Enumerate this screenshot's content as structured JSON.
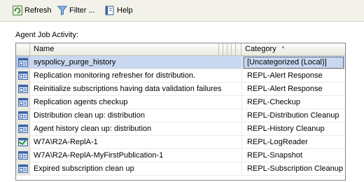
{
  "toolbar": {
    "refresh_label": "Refresh",
    "filter_label": "Filter ...",
    "help_label": "Help"
  },
  "activity_label": "Agent Job Activity:",
  "grid": {
    "columns": {
      "name": "Name",
      "category": "Category"
    },
    "sort_indicator": "▲",
    "rows": [
      {
        "name": "syspolicy_purge_history",
        "category": "[Uncategorized (Local)]",
        "icon": "job-icon",
        "selected": true
      },
      {
        "name": "Replication monitoring refresher for distribution.",
        "category": "REPL-Alert Response",
        "icon": "job-icon",
        "selected": false
      },
      {
        "name": "Reinitialize subscriptions having data validation failures",
        "category": "REPL-Alert Response",
        "icon": "job-icon",
        "selected": false
      },
      {
        "name": "Replication agents checkup",
        "category": "REPL-Checkup",
        "icon": "job-icon",
        "selected": false
      },
      {
        "name": "Distribution clean up: distribution",
        "category": "REPL-Distribution Cleanup",
        "icon": "job-icon",
        "selected": false
      },
      {
        "name": "Agent history clean up: distribution",
        "category": "REPL-History Cleanup",
        "icon": "job-icon",
        "selected": false
      },
      {
        "name": "W7A\\R2A-ReplA-1",
        "category": "REPL-LogReader",
        "icon": "job-running-icon",
        "selected": false
      },
      {
        "name": "W7A\\R2A-ReplA-MyFirstPublication-1",
        "category": "REPL-Snapshot",
        "icon": "job-icon",
        "selected": false
      },
      {
        "name": "Expired subscription clean up",
        "category": "REPL-Subscription Cleanup",
        "icon": "job-icon",
        "selected": false
      }
    ]
  },
  "colors": {
    "selection": "#c9d8f0",
    "toolbar_bg": "#f2f1ea",
    "grid_border": "#828790"
  }
}
